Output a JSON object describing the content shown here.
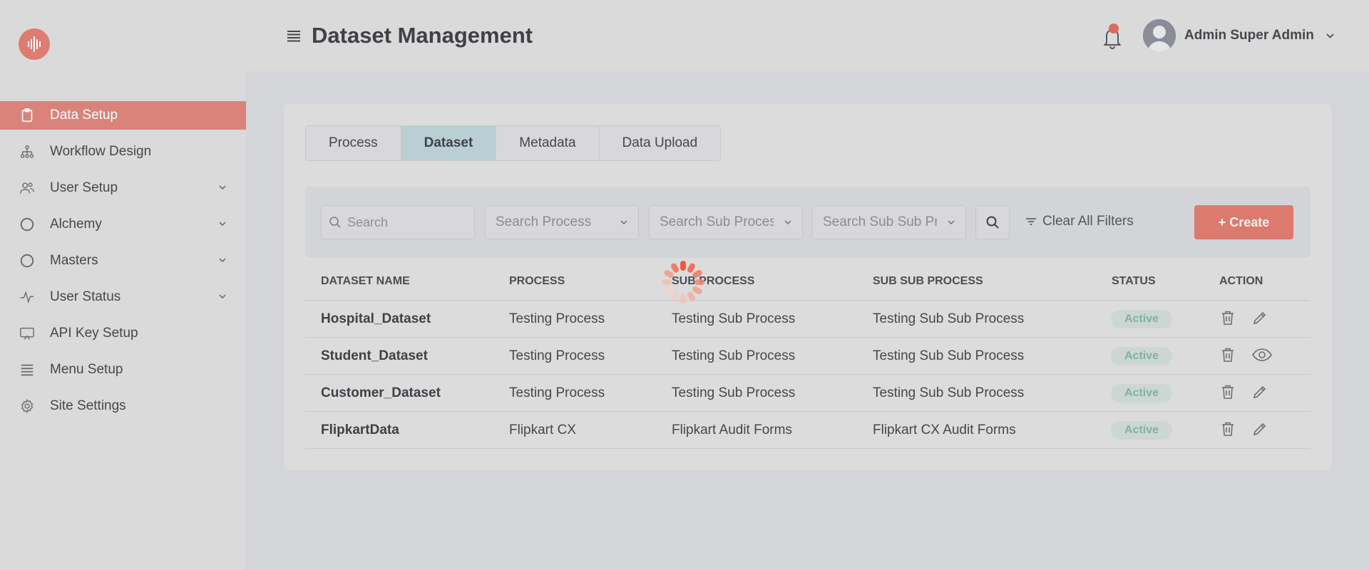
{
  "header": {
    "title": "Dataset Management",
    "user_name": "Admin Super Admin"
  },
  "sidebar": {
    "items": [
      {
        "label": "Data Setup",
        "icon": "clipboard-icon",
        "active": true,
        "has_children": false
      },
      {
        "label": "Workflow Design",
        "icon": "hierarchy-icon",
        "active": false,
        "has_children": false
      },
      {
        "label": "User Setup",
        "icon": "users-icon",
        "active": false,
        "has_children": true
      },
      {
        "label": "Alchemy",
        "icon": "circle-icon",
        "active": false,
        "has_children": true
      },
      {
        "label": "Masters",
        "icon": "circle-icon",
        "active": false,
        "has_children": true
      },
      {
        "label": "User Status",
        "icon": "activity-icon",
        "active": false,
        "has_children": true
      },
      {
        "label": "API Key Setup",
        "icon": "monitor-icon",
        "active": false,
        "has_children": false
      },
      {
        "label": "Menu Setup",
        "icon": "list-icon",
        "active": false,
        "has_children": false
      },
      {
        "label": "Site Settings",
        "icon": "gear-icon",
        "active": false,
        "has_children": false
      }
    ]
  },
  "tabs": [
    {
      "label": "Process",
      "active": false
    },
    {
      "label": "Dataset",
      "active": true
    },
    {
      "label": "Metadata",
      "active": false
    },
    {
      "label": "Data Upload",
      "active": false
    }
  ],
  "filters": {
    "search_placeholder": "Search",
    "process_placeholder": "Search Process",
    "sub_process_placeholder": "Search Sub Process",
    "sub_sub_process_placeholder": "Search Sub Sub Process",
    "clear_label": "Clear All Filters",
    "create_label": "+ Create"
  },
  "table": {
    "columns": [
      "DATASET NAME",
      "PROCESS",
      "SUB PROCESS",
      "SUB SUB PROCESS",
      "STATUS",
      "ACTION"
    ],
    "rows": [
      {
        "name": "Hospital_Dataset",
        "process": "Testing Process",
        "sub_process": "Testing Sub Process",
        "sub_sub_process": "Testing Sub Sub Process",
        "status": "Active",
        "second_action": "edit"
      },
      {
        "name": "Student_Dataset",
        "process": "Testing Process",
        "sub_process": "Testing Sub Process",
        "sub_sub_process": "Testing Sub Sub Process",
        "status": "Active",
        "second_action": "view"
      },
      {
        "name": "Customer_Dataset",
        "process": "Testing Process",
        "sub_process": "Testing Sub Process",
        "sub_sub_process": "Testing Sub Sub Process",
        "status": "Active",
        "second_action": "edit"
      },
      {
        "name": "FlipkartData",
        "process": "Flipkart CX",
        "sub_process": "Flipkart Audit Forms",
        "sub_sub_process": "Flipkart CX Audit Forms",
        "status": "Active",
        "second_action": "edit"
      }
    ]
  },
  "colors": {
    "accent": "#dc7a6f",
    "active_tab": "#b9cfd3",
    "status_text": "#7fb49a"
  }
}
